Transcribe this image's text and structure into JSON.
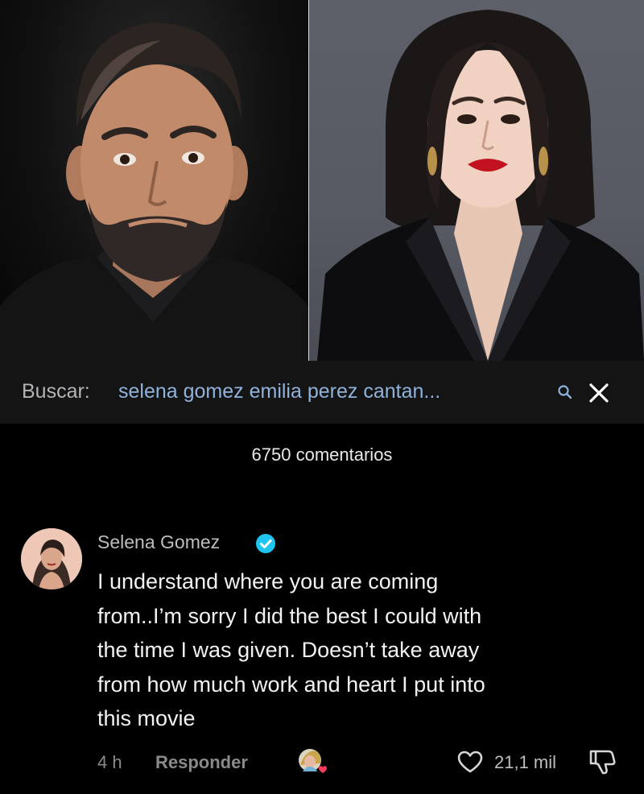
{
  "search": {
    "label": "Buscar:",
    "query": "selena gomez emilia perez cantan...",
    "icon": "search-icon",
    "close_icon": "close-icon"
  },
  "comments": {
    "count_label": "6750 comentarios"
  },
  "comment": {
    "author": "Selena Gomez",
    "verified": true,
    "text_lines": [
      "I understand where you are coming",
      "from..I’m sorry I did the best I could with",
      "the time I was given. Doesn’t take away",
      "from how much work and heart I put into",
      "this movie"
    ],
    "time": "4 h",
    "reply_label": "Responder",
    "likes": "21,1 mil"
  },
  "colors": {
    "background": "#000000",
    "search_bar": "#141414",
    "query_link": "#8fb3dc",
    "verified": "#20c4f0",
    "muted_text": "#8a8a8a"
  }
}
